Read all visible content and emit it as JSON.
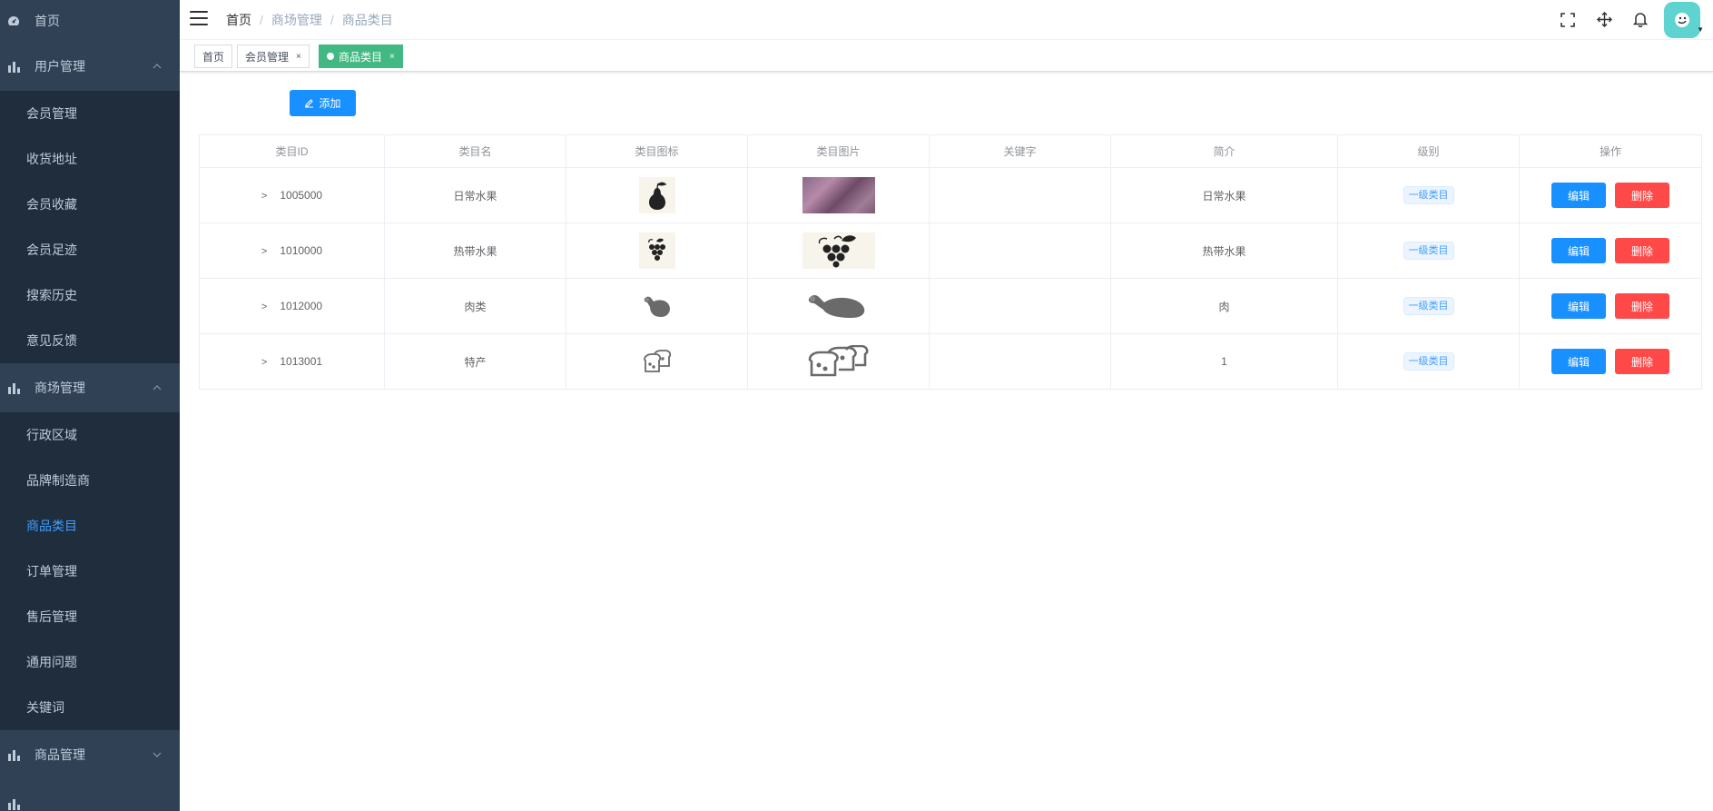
{
  "sidebar": {
    "home": "首页",
    "groups": [
      {
        "label": "用户管理",
        "expanded": true,
        "items": [
          "会员管理",
          "收货地址",
          "会员收藏",
          "会员足迹",
          "搜索历史",
          "意见反馈"
        ]
      },
      {
        "label": "商场管理",
        "expanded": true,
        "items": [
          "行政区域",
          "品牌制造商",
          "商品类目",
          "订单管理",
          "售后管理",
          "通用问题",
          "关键词"
        ]
      },
      {
        "label": "商品管理",
        "expanded": false,
        "items": []
      }
    ],
    "active_item": "商品类目"
  },
  "navbar": {
    "breadcrumb": [
      "首页",
      "商场管理",
      "商品类目"
    ],
    "breadcrumb_sep": "/"
  },
  "tags": [
    {
      "label": "首页",
      "closable": false,
      "active": false
    },
    {
      "label": "会员管理",
      "closable": true,
      "active": false
    },
    {
      "label": "商品类目",
      "closable": true,
      "active": true
    }
  ],
  "toolbar": {
    "add_label": "添加"
  },
  "table": {
    "columns": [
      "类目ID",
      "类目名",
      "类目图标",
      "类目图片",
      "关键字",
      "简介",
      "级别",
      "操作"
    ],
    "rows": [
      {
        "id": "1005000",
        "name": "日常水果",
        "icon": "pear-icon",
        "pic": "plum-photo",
        "keywords": "",
        "desc": "日常水果",
        "level": "一级类目"
      },
      {
        "id": "1010000",
        "name": "热带水果",
        "icon": "grapes-icon",
        "pic": "grapes-icon",
        "keywords": "",
        "desc": "热带水果",
        "level": "一级类目"
      },
      {
        "id": "1012000",
        "name": "肉类",
        "icon": "meat-icon",
        "pic": "meat-icon",
        "keywords": "",
        "desc": "肉",
        "level": "一级类目"
      },
      {
        "id": "1013001",
        "name": "特产",
        "icon": "bread-icon",
        "pic": "bread-icon",
        "keywords": "",
        "desc": "1",
        "level": "一级类目"
      }
    ],
    "edit_label": "编辑",
    "delete_label": "删除"
  },
  "colors": {
    "sidebar_bg": "#304156",
    "submenu_bg": "#1f2d3d",
    "active_menu": "#409eff",
    "primary": "#1890ff",
    "danger": "#ff4949",
    "tag_active": "#42b983"
  }
}
